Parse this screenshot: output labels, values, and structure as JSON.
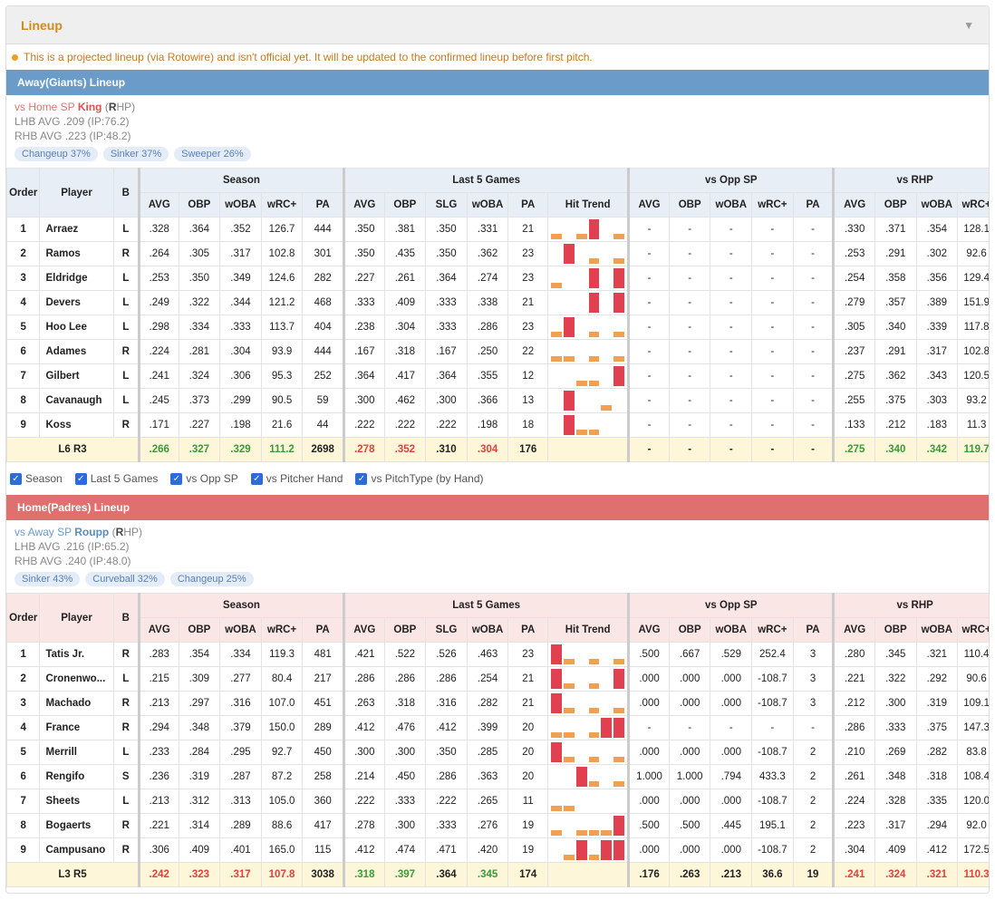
{
  "panel": {
    "title": "Lineup",
    "note": "This is a projected lineup (via Rotowire) and isn't official yet. It will be updated to the confirmed lineup before first pitch."
  },
  "colors": {
    "accent": "#d18a1e",
    "away": "#6a9bc9",
    "home": "#e07070",
    "bar_hit": "#e04050",
    "bar_out": "#f0a050"
  },
  "headers": {
    "groups": [
      "Season",
      "Last 5 Games",
      "vs Opp SP",
      "vs RHP"
    ],
    "order": "Order",
    "player": "Player",
    "b": "B",
    "season": [
      "AVG",
      "OBP",
      "wOBA",
      "wRC+",
      "PA"
    ],
    "last5": [
      "AVG",
      "OBP",
      "SLG",
      "wOBA",
      "PA",
      "Hit Trend"
    ],
    "vsopp": [
      "AVG",
      "OBP",
      "wOBA",
      "wRC+",
      "PA"
    ],
    "vsrhp": [
      "AVG",
      "OBP",
      "wOBA",
      "wRC+"
    ]
  },
  "away": {
    "title": "Away(Giants) Lineup",
    "sp_prefix": "vs Home SP",
    "sp_name": "King",
    "sp_hand_open": " (",
    "sp_hand_letter": "R",
    "sp_hand_close": "HP)",
    "lhb": "LHB AVG .209 (IP:76.2)",
    "rhb": "RHB AVG .223 (IP:48.2)",
    "pitches": [
      "Changeup 37%",
      "Sinker 37%",
      "Sweeper 26%"
    ],
    "rows": [
      {
        "ord": "1",
        "name": "Arraez",
        "b": "L",
        "s": [
          ".328",
          ".364",
          ".352",
          "126.7",
          "444"
        ],
        "l": [
          ".350",
          ".381",
          ".350",
          ".331",
          "21"
        ],
        "t": [
          1,
          0,
          1,
          2,
          0,
          1
        ],
        "o": [
          "-",
          "-",
          "-",
          "-",
          "-"
        ],
        "r": [
          ".330",
          ".371",
          ".354",
          "128.1"
        ]
      },
      {
        "ord": "2",
        "name": "Ramos",
        "b": "R",
        "s": [
          ".264",
          ".305",
          ".317",
          "102.8",
          "301"
        ],
        "l": [
          ".350",
          ".435",
          ".350",
          ".362",
          "23"
        ],
        "t": [
          0,
          2,
          0,
          1,
          0,
          1
        ],
        "o": [
          "-",
          "-",
          "-",
          "-",
          "-"
        ],
        "r": [
          ".253",
          ".291",
          ".302",
          "92.6"
        ]
      },
      {
        "ord": "3",
        "name": "Eldridge",
        "b": "L",
        "s": [
          ".253",
          ".350",
          ".349",
          "124.6",
          "282"
        ],
        "l": [
          ".227",
          ".261",
          ".364",
          ".274",
          "23"
        ],
        "t": [
          1,
          0,
          0,
          2,
          0,
          2
        ],
        "o": [
          "-",
          "-",
          "-",
          "-",
          "-"
        ],
        "r": [
          ".254",
          ".358",
          ".356",
          "129.4"
        ]
      },
      {
        "ord": "4",
        "name": "Devers",
        "b": "L",
        "s": [
          ".249",
          ".322",
          ".344",
          "121.2",
          "468"
        ],
        "l": [
          ".333",
          ".409",
          ".333",
          ".338",
          "21"
        ],
        "t": [
          0,
          0,
          0,
          2,
          0,
          2
        ],
        "o": [
          "-",
          "-",
          "-",
          "-",
          "-"
        ],
        "r": [
          ".279",
          ".357",
          ".389",
          "151.9"
        ]
      },
      {
        "ord": "5",
        "name": "Hoo Lee",
        "b": "L",
        "s": [
          ".298",
          ".334",
          ".333",
          "113.7",
          "404"
        ],
        "l": [
          ".238",
          ".304",
          ".333",
          ".286",
          "23"
        ],
        "t": [
          1,
          2,
          0,
          1,
          0,
          1
        ],
        "o": [
          "-",
          "-",
          "-",
          "-",
          "-"
        ],
        "r": [
          ".305",
          ".340",
          ".339",
          "117.8"
        ]
      },
      {
        "ord": "6",
        "name": "Adames",
        "b": "R",
        "s": [
          ".224",
          ".281",
          ".304",
          "93.9",
          "444"
        ],
        "l": [
          ".167",
          ".318",
          ".167",
          ".250",
          "22"
        ],
        "t": [
          1,
          1,
          0,
          1,
          0,
          1
        ],
        "o": [
          "-",
          "-",
          "-",
          "-",
          "-"
        ],
        "r": [
          ".237",
          ".291",
          ".317",
          "102.8"
        ]
      },
      {
        "ord": "7",
        "name": "Gilbert",
        "b": "L",
        "s": [
          ".241",
          ".324",
          ".306",
          "95.3",
          "252"
        ],
        "l": [
          ".364",
          ".417",
          ".364",
          ".355",
          "12"
        ],
        "t": [
          0,
          0,
          1,
          1,
          0,
          2
        ],
        "o": [
          "-",
          "-",
          "-",
          "-",
          "-"
        ],
        "r": [
          ".275",
          ".362",
          ".343",
          "120.5"
        ]
      },
      {
        "ord": "8",
        "name": "Cavanaugh",
        "b": "L",
        "s": [
          ".245",
          ".373",
          ".299",
          "90.5",
          "59"
        ],
        "l": [
          ".300",
          ".462",
          ".300",
          ".366",
          "13"
        ],
        "t": [
          0,
          2,
          0,
          0,
          1,
          0
        ],
        "o": [
          "-",
          "-",
          "-",
          "-",
          "-"
        ],
        "r": [
          ".255",
          ".375",
          ".303",
          "93.2"
        ]
      },
      {
        "ord": "9",
        "name": "Koss",
        "b": "R",
        "s": [
          ".171",
          ".227",
          ".198",
          "21.6",
          "44"
        ],
        "l": [
          ".222",
          ".222",
          ".222",
          ".198",
          "18"
        ],
        "t": [
          0,
          2,
          1,
          1,
          0,
          0
        ],
        "o": [
          "-",
          "-",
          "-",
          "-",
          "-"
        ],
        "r": [
          ".133",
          ".212",
          ".183",
          "11.3"
        ]
      }
    ],
    "total": {
      "label_l": "L6",
      "label_r": "R3",
      "s": [
        ".266",
        ".327",
        ".329",
        "111.2",
        "2698"
      ],
      "l": [
        ".278",
        ".352",
        ".310",
        ".304",
        "176"
      ],
      "o": [
        "-",
        "-",
        "-",
        "-",
        "-"
      ],
      "r": [
        ".275",
        ".340",
        ".342",
        "119.7"
      ]
    }
  },
  "filters": [
    "Season",
    "Last 5 Games",
    "vs Opp SP",
    "vs Pitcher Hand",
    "vs PitchType (by Hand)"
  ],
  "home": {
    "title": "Home(Padres) Lineup",
    "sp_prefix": "vs Away SP",
    "sp_name": "Roupp",
    "sp_hand_open": " (",
    "sp_hand_letter": "R",
    "sp_hand_close": "HP)",
    "lhb": "LHB AVG .216 (IP:65.2)",
    "rhb": "RHB AVG .240 (IP:48.0)",
    "pitches": [
      "Sinker 43%",
      "Curveball 32%",
      "Changeup 25%"
    ],
    "rows": [
      {
        "ord": "1",
        "name": "Tatis Jr.",
        "b": "R",
        "s": [
          ".283",
          ".354",
          ".334",
          "119.3",
          "481"
        ],
        "l": [
          ".421",
          ".522",
          ".526",
          ".463",
          "23"
        ],
        "t": [
          2,
          1,
          0,
          1,
          0,
          1
        ],
        "o": [
          ".500",
          ".667",
          ".529",
          "252.4",
          "3"
        ],
        "r": [
          ".280",
          ".345",
          ".321",
          "110.4"
        ]
      },
      {
        "ord": "2",
        "name": "Cronenwo...",
        "b": "L",
        "s": [
          ".215",
          ".309",
          ".277",
          "80.4",
          "217"
        ],
        "l": [
          ".286",
          ".286",
          ".286",
          ".254",
          "21"
        ],
        "t": [
          2,
          1,
          0,
          1,
          0,
          2
        ],
        "o": [
          ".000",
          ".000",
          ".000",
          "-108.7",
          "3"
        ],
        "r": [
          ".221",
          ".322",
          ".292",
          "90.6"
        ]
      },
      {
        "ord": "3",
        "name": "Machado",
        "b": "R",
        "s": [
          ".213",
          ".297",
          ".316",
          "107.0",
          "451"
        ],
        "l": [
          ".263",
          ".318",
          ".316",
          ".282",
          "21"
        ],
        "t": [
          2,
          1,
          0,
          1,
          0,
          1
        ],
        "o": [
          ".000",
          ".000",
          ".000",
          "-108.7",
          "3"
        ],
        "r": [
          ".212",
          ".300",
          ".319",
          "109.1"
        ]
      },
      {
        "ord": "4",
        "name": "France",
        "b": "R",
        "s": [
          ".294",
          ".348",
          ".379",
          "150.0",
          "289"
        ],
        "l": [
          ".412",
          ".476",
          ".412",
          ".399",
          "20"
        ],
        "t": [
          1,
          1,
          0,
          1,
          2,
          2
        ],
        "o": [
          "-",
          "-",
          "-",
          "-",
          "-"
        ],
        "r": [
          ".286",
          ".333",
          ".375",
          "147.3"
        ]
      },
      {
        "ord": "5",
        "name": "Merrill",
        "b": "L",
        "s": [
          ".233",
          ".284",
          ".295",
          "92.7",
          "450"
        ],
        "l": [
          ".300",
          ".300",
          ".350",
          ".285",
          "20"
        ],
        "t": [
          2,
          1,
          0,
          1,
          0,
          1
        ],
        "o": [
          ".000",
          ".000",
          ".000",
          "-108.7",
          "2"
        ],
        "r": [
          ".210",
          ".269",
          ".282",
          "83.8"
        ]
      },
      {
        "ord": "6",
        "name": "Rengifo",
        "b": "S",
        "s": [
          ".236",
          ".319",
          ".287",
          "87.2",
          "258"
        ],
        "l": [
          ".214",
          ".450",
          ".286",
          ".363",
          "20"
        ],
        "t": [
          0,
          0,
          2,
          1,
          0,
          1
        ],
        "o": [
          "1.000",
          "1.000",
          ".794",
          "433.3",
          "2"
        ],
        "r": [
          ".261",
          ".348",
          ".318",
          "108.4"
        ]
      },
      {
        "ord": "7",
        "name": "Sheets",
        "b": "L",
        "s": [
          ".213",
          ".312",
          ".313",
          "105.0",
          "360"
        ],
        "l": [
          ".222",
          ".333",
          ".222",
          ".265",
          "11"
        ],
        "t": [
          1,
          1,
          0,
          0,
          0,
          0
        ],
        "o": [
          ".000",
          ".000",
          ".000",
          "-108.7",
          "2"
        ],
        "r": [
          ".224",
          ".328",
          ".335",
          "120.0"
        ]
      },
      {
        "ord": "8",
        "name": "Bogaerts",
        "b": "R",
        "s": [
          ".221",
          ".314",
          ".289",
          "88.6",
          "417"
        ],
        "l": [
          ".278",
          ".300",
          ".333",
          ".276",
          "19"
        ],
        "t": [
          1,
          0,
          1,
          1,
          1,
          2
        ],
        "o": [
          ".500",
          ".500",
          ".445",
          "195.1",
          "2"
        ],
        "r": [
          ".223",
          ".317",
          ".294",
          "92.0"
        ]
      },
      {
        "ord": "9",
        "name": "Campusano",
        "b": "R",
        "s": [
          ".306",
          ".409",
          ".401",
          "165.0",
          "115"
        ],
        "l": [
          ".412",
          ".474",
          ".471",
          ".420",
          "19"
        ],
        "t": [
          0,
          1,
          2,
          1,
          2,
          2
        ],
        "o": [
          ".000",
          ".000",
          ".000",
          "-108.7",
          "2"
        ],
        "r": [
          ".304",
          ".409",
          ".412",
          "172.5"
        ]
      }
    ],
    "total": {
      "label_l": "L3",
      "label_r": "R5",
      "s": [
        ".242",
        ".323",
        ".317",
        "107.8",
        "3038"
      ],
      "l": [
        ".318",
        ".397",
        ".364",
        ".345",
        "174"
      ],
      "o": [
        ".176",
        ".263",
        ".213",
        "36.6",
        "19"
      ],
      "r": [
        ".241",
        ".324",
        ".321",
        "110.3"
      ]
    }
  }
}
